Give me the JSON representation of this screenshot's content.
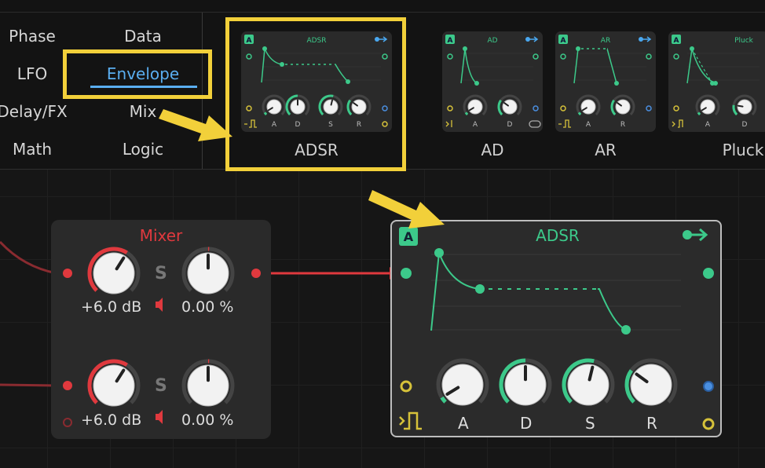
{
  "browser": {
    "categories": [
      {
        "label": "Phase",
        "active": false
      },
      {
        "label": "Data",
        "active": false
      },
      {
        "label": "LFO",
        "active": false
      },
      {
        "label": "Envelope",
        "active": true
      },
      {
        "label": "Delay/FX",
        "active": false
      },
      {
        "label": "Mix",
        "active": false
      },
      {
        "label": "Math",
        "active": false
      },
      {
        "label": "Logic",
        "active": false
      }
    ],
    "presets": [
      {
        "name": "ADSR",
        "badge": "A",
        "title": "ADSR",
        "knobs": [
          "A",
          "D",
          "S",
          "R"
        ]
      },
      {
        "name": "AD",
        "badge": "A",
        "title": "AD",
        "knobs": [
          "A",
          "D"
        ]
      },
      {
        "name": "AR",
        "badge": "A",
        "title": "AR",
        "knobs": [
          "A",
          "R"
        ]
      },
      {
        "name": "Pluck",
        "badge": "A",
        "title": "Pluck",
        "knobs": [
          "A",
          "D"
        ]
      }
    ]
  },
  "mixer": {
    "title": "Mixer",
    "channels": [
      {
        "gain": "+6.0 dB",
        "solo": "S",
        "pan": "0.00 %"
      },
      {
        "gain": "+6.0 dB",
        "solo": "S",
        "pan": "0.00 %"
      }
    ]
  },
  "adsr_module": {
    "badge": "A",
    "title": "ADSR",
    "knobs": [
      {
        "label": "A",
        "value": 0.05
      },
      {
        "label": "D",
        "value": 0.5
      },
      {
        "label": "S",
        "value": 0.55
      },
      {
        "label": "R",
        "value": 0.3
      }
    ]
  },
  "colors": {
    "accent": "#3cc98a",
    "mixer_red": "#e0393e",
    "highlight": "#f2d03a",
    "selection_blue": "#5aaef0",
    "port_blue": "#4a8fe0",
    "port_yellow": "#d6c23a"
  },
  "icons": [
    "arrow-output-icon",
    "gate-pulse-icon",
    "speaker-icon",
    "loop-icon"
  ]
}
